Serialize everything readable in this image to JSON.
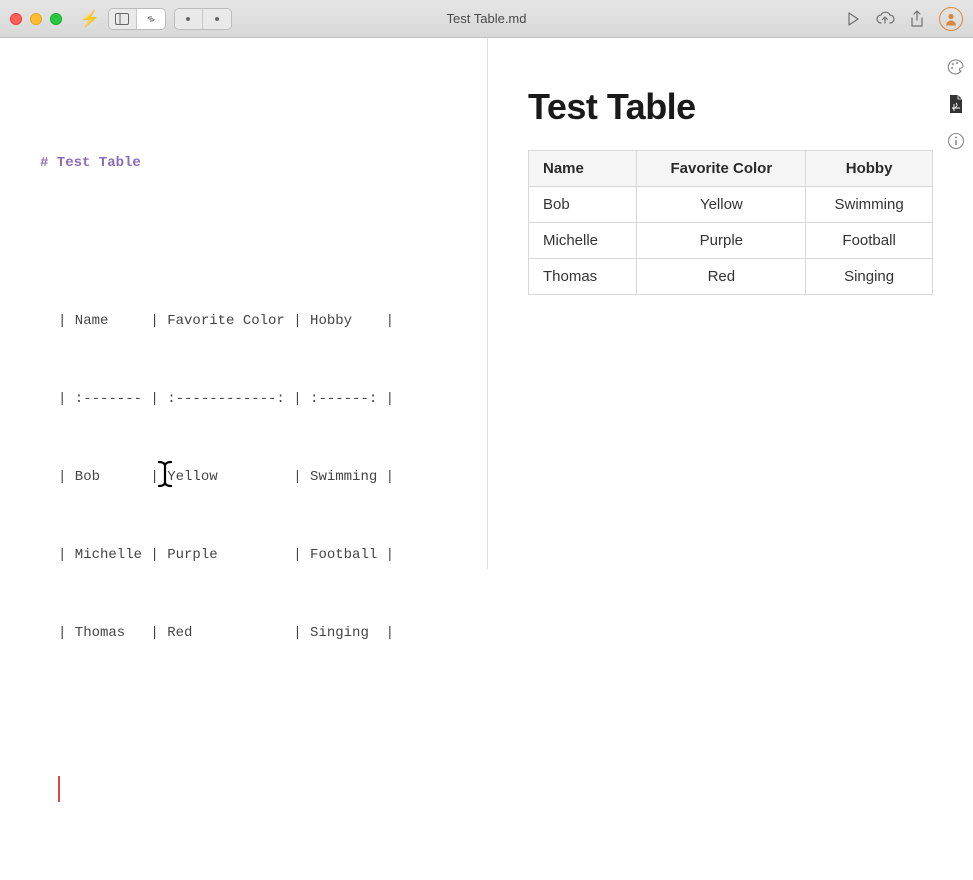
{
  "window": {
    "filename": "Test Table.md"
  },
  "editor": {
    "heading": "# Test Table",
    "lines": [
      "| Name     | Favorite Color | Hobby    |",
      "| :------- | :------------: | :------: |",
      "| Bob      | Yellow         | Swimming |",
      "| Michelle | Purple         | Football |",
      "| Thomas   | Red            | Singing  |"
    ]
  },
  "preview": {
    "title": "Test Table",
    "table": {
      "headers": {
        "name": "Name",
        "color": "Favorite Color",
        "hobby": "Hobby"
      },
      "rows": [
        {
          "name": "Bob",
          "color": "Yellow",
          "hobby": "Swimming"
        },
        {
          "name": "Michelle",
          "color": "Purple",
          "hobby": "Football"
        },
        {
          "name": "Thomas",
          "color": "Red",
          "hobby": "Singing"
        }
      ]
    }
  },
  "icons": {
    "bolt": "⚡"
  }
}
